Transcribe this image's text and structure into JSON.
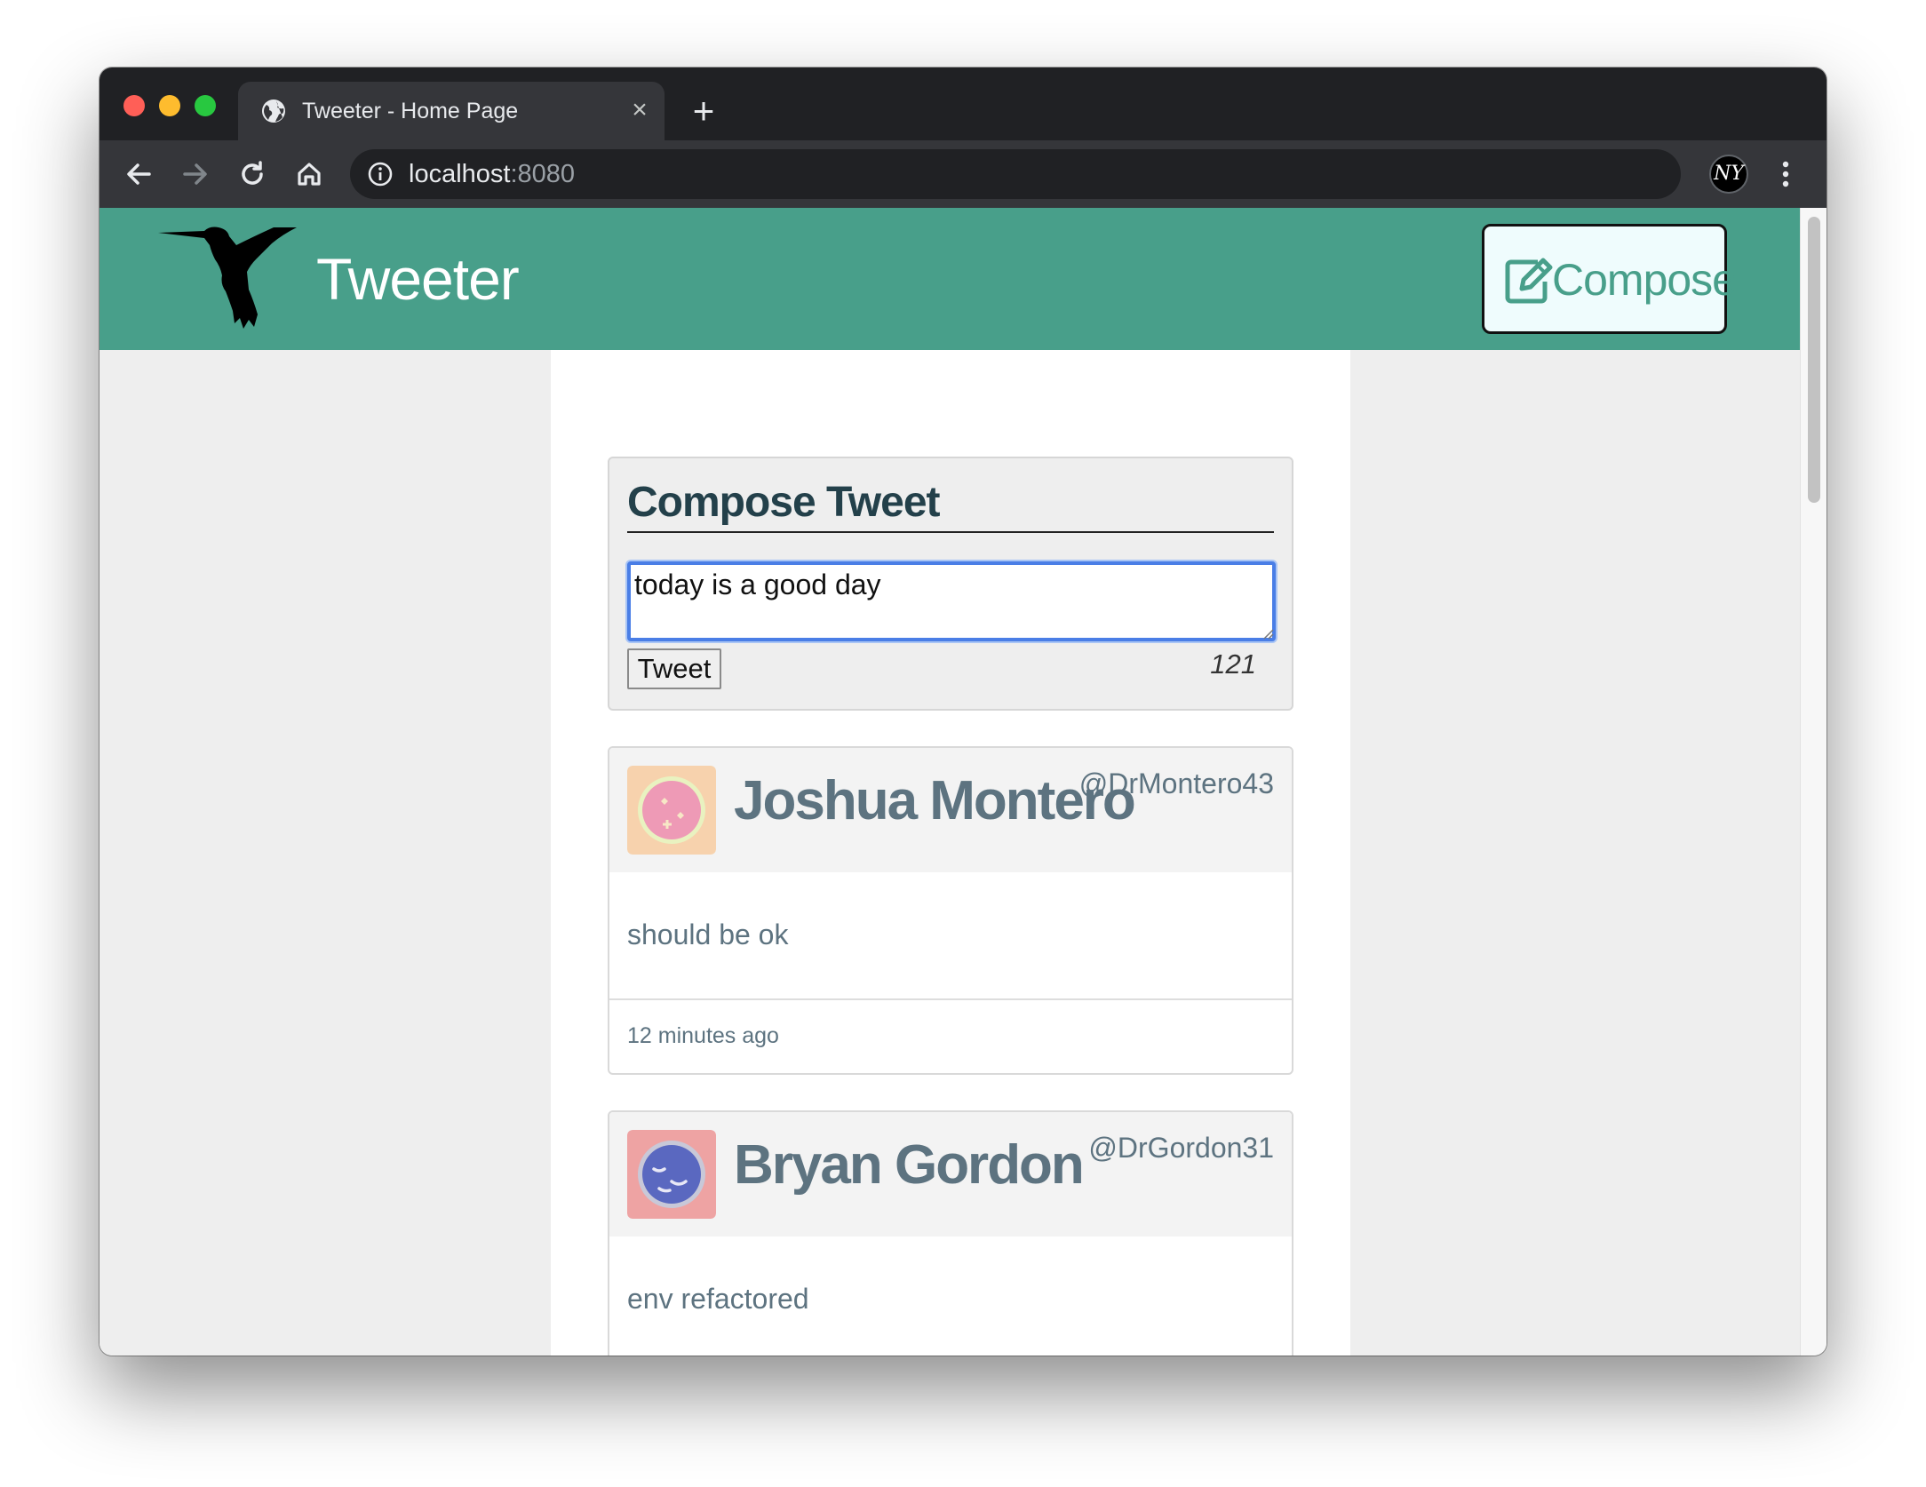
{
  "browser": {
    "tab_title": "Tweeter - Home Page",
    "tab_close_icon": "close-icon",
    "new_tab_icon": "plus-icon",
    "url_host": "localhost",
    "url_port": ":8080",
    "profile_initials": "NY"
  },
  "header": {
    "brand": "Tweeter",
    "compose_label": "Compose",
    "accent_color": "#489f8a"
  },
  "new_tweet": {
    "title": "Compose Tweet",
    "text": "today is a good day",
    "button_label": "Tweet",
    "counter": "121"
  },
  "tweets": [
    {
      "name": "Joshua Montero",
      "handle": "@DrMontero43",
      "content": "should be ok",
      "time": "12 minutes ago"
    },
    {
      "name": "Bryan Gordon",
      "handle": "@DrGordon31",
      "content": "env refactored"
    }
  ]
}
